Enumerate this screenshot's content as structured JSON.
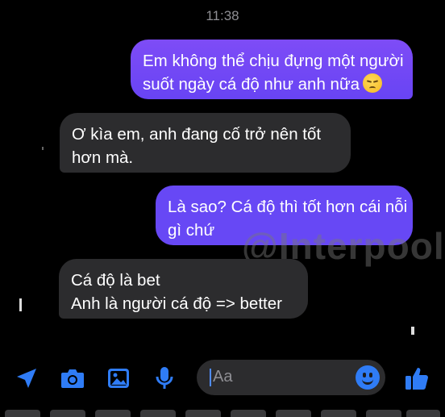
{
  "status": {
    "time": "11:38"
  },
  "messages": [
    {
      "side": "outgoing",
      "lines": [
        "Em không thể chịu đựng một người",
        "suốt ngày cá độ như anh nữa"
      ],
      "emoji": "disappointed-face"
    },
    {
      "side": "incoming",
      "lines": [
        "Ơ kìa em, anh đang cố trở nên tốt",
        "hơn mà."
      ]
    },
    {
      "side": "outgoing",
      "lines": [
        "Là sao? Cá độ thì tốt hơn cái nỗi",
        "gì chứ"
      ]
    },
    {
      "side": "incoming",
      "lines": [
        "Cá độ là bet",
        "Anh là người cá độ => better"
      ]
    }
  ],
  "watermark": "@Interpool",
  "composer": {
    "placeholder": "Aa",
    "icons": [
      "send-location-icon",
      "camera-icon",
      "photo-icon",
      "microphone-icon",
      "emoji-icon",
      "like-icon"
    ]
  },
  "colors": {
    "outgoing_bubble": "#6a46f5",
    "incoming_bubble": "#2c2c2e",
    "accent": "#2f7cf6"
  }
}
